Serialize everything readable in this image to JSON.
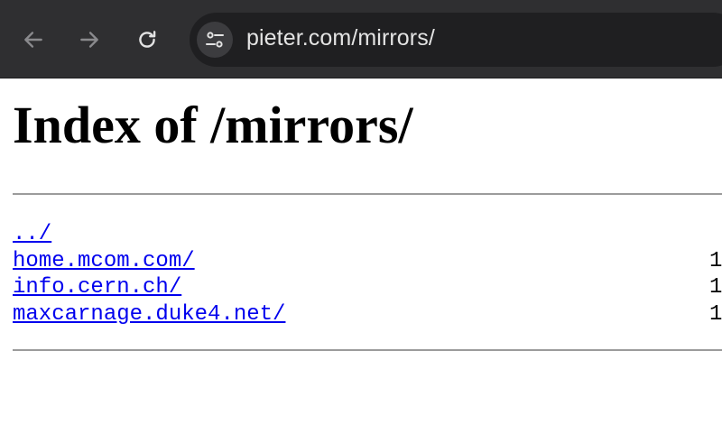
{
  "browser": {
    "url": "pieter.com/mirrors/"
  },
  "page": {
    "title": "Index of /mirrors/",
    "entries": [
      {
        "name": "../",
        "date": ""
      },
      {
        "name": "home.mcom.com/",
        "date": "1"
      },
      {
        "name": "info.cern.ch/",
        "date": "1"
      },
      {
        "name": "maxcarnage.duke4.net/",
        "date": "1"
      }
    ]
  },
  "icons": {
    "back": "back-arrow-icon",
    "forward": "forward-arrow-icon",
    "reload": "reload-icon",
    "site_info": "tune-icon"
  },
  "colors": {
    "toolbar": "#2f2f31",
    "omnibox": "#1f1f21",
    "link": "#0000ee",
    "rule": "#9b9b9b"
  }
}
